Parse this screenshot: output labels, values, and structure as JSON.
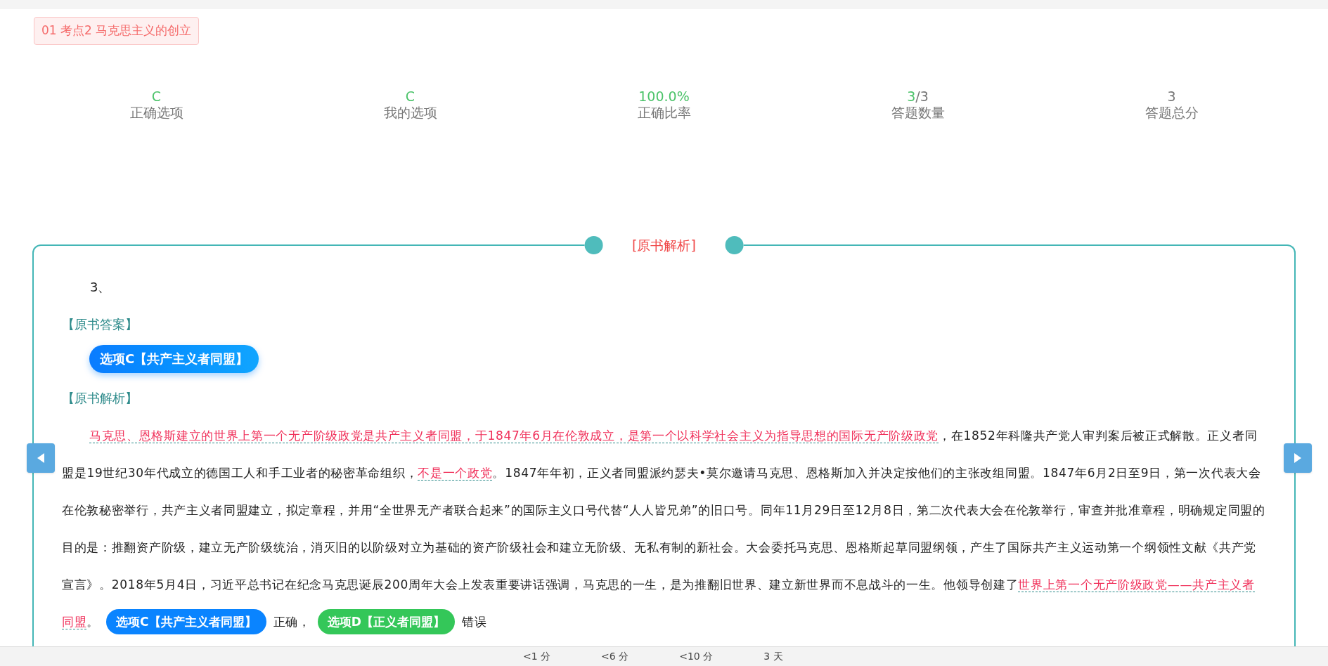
{
  "topic_badge": "01 考点2 马克思主义的创立",
  "stats": [
    {
      "value": [
        {
          "text": "C",
          "highlight": true
        }
      ],
      "label": "正确选项"
    },
    {
      "value": [
        {
          "text": "C",
          "highlight": true
        }
      ],
      "label": "我的选项"
    },
    {
      "value": [
        {
          "text": "100.0%",
          "highlight": true
        }
      ],
      "label": "正确比率"
    },
    {
      "value": [
        {
          "text": "3",
          "highlight": true
        },
        {
          "text": "/3",
          "highlight": false
        }
      ],
      "label": "答题数量"
    },
    {
      "value": [
        {
          "text": "3",
          "highlight": false
        }
      ],
      "label": "答题总分"
    }
  ],
  "panel": {
    "title": "[原书解析]",
    "question_number": "3、",
    "answer_heading": "【原书答案】",
    "answer_button": "选项C【共产主义者同盟】",
    "analysis_heading": "【原书解析】",
    "analysis": [
      {
        "kind": "highlight",
        "text": "马克思、恩格斯建立的世界上第一个无产阶级政党是共产主义者同盟，于1847年6月在伦敦成立，是第一个以科学社会主义为指导思想的国际无产阶级政党"
      },
      {
        "kind": "plain",
        "text": "，在1852年科隆共产党人审判案后被正式解散。正义者同盟是19世纪30年代成立的德国工人和手工业者的秘密革命组织，"
      },
      {
        "kind": "highlight",
        "text": "不是一个政党"
      },
      {
        "kind": "plain",
        "text": "。1847年年初，正义者同盟派约瑟夫•莫尔邀请马克思、恩格斯加入并决定按他们的主张改组同盟。1847年6月2日至9日，第一次代表大会在伦敦秘密举行，共产主义者同盟建立，拟定章程，并用“全世界无产者联合起来”的国际主义口号代替“人人皆兄弟”的旧口号。同年11月29日至12月8日，第二次代表大会在伦敦举行，审查并批准章程，明确规定同盟的目的是：推翻资产阶级，建立无产阶级统治，消灭旧的以阶级对立为基础的资产阶级社会和建立无阶级、无私有制的新社会。大会委托马克思、恩格斯起草同盟纲领，产生了国际共产主义运动第一个纲领性文献《共产党宣言》。2018年5月4日，习近平总书记在纪念马克思诞辰200周年大会上发表重要讲话强调，马克思的一生，是为推翻旧世界、建立新世界而不息战斗的一生。他领导创建了"
      },
      {
        "kind": "highlight",
        "text": "世界上第一个无产阶级政党——共产主义者同盟"
      },
      {
        "kind": "plain",
        "text": "。"
      },
      {
        "kind": "option",
        "text": "选项C【共产主义者同盟】",
        "color": "#0a84ff"
      },
      {
        "kind": "plain",
        "text": "正确，"
      },
      {
        "kind": "option",
        "text": "选项D【正义者同盟】",
        "color": "#34c759"
      },
      {
        "kind": "plain",
        "text": "错误"
      }
    ]
  },
  "footer": [
    "<1 分",
    "<6 分",
    "<10 分",
    "3 天"
  ]
}
